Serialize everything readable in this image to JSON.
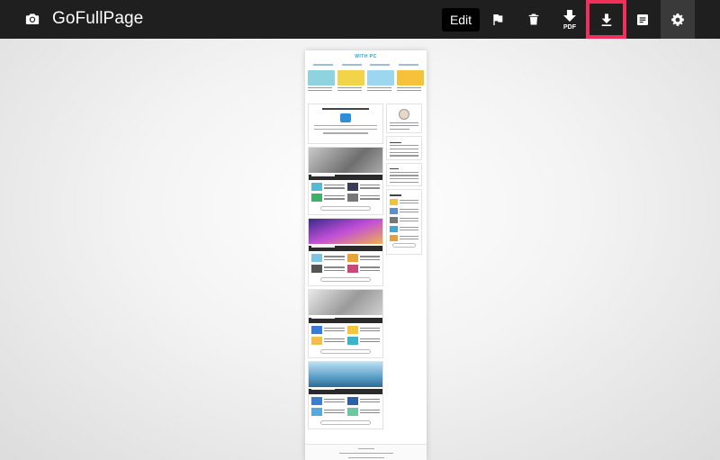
{
  "app": {
    "title": "GoFullPage",
    "icon": "camera-icon"
  },
  "toolbar": {
    "edit_label": "Edit",
    "buttons": [
      {
        "name": "flag-icon"
      },
      {
        "name": "trash-icon"
      },
      {
        "name": "pdf-download-icon",
        "label": "PDF"
      },
      {
        "name": "download-icon",
        "highlighted": true
      },
      {
        "name": "document-icon"
      },
      {
        "name": "gear-icon"
      }
    ],
    "highlight_color": "#f0305b"
  },
  "preview": {
    "site_title": "WITH PC",
    "accent_color": "#27a3d6"
  }
}
